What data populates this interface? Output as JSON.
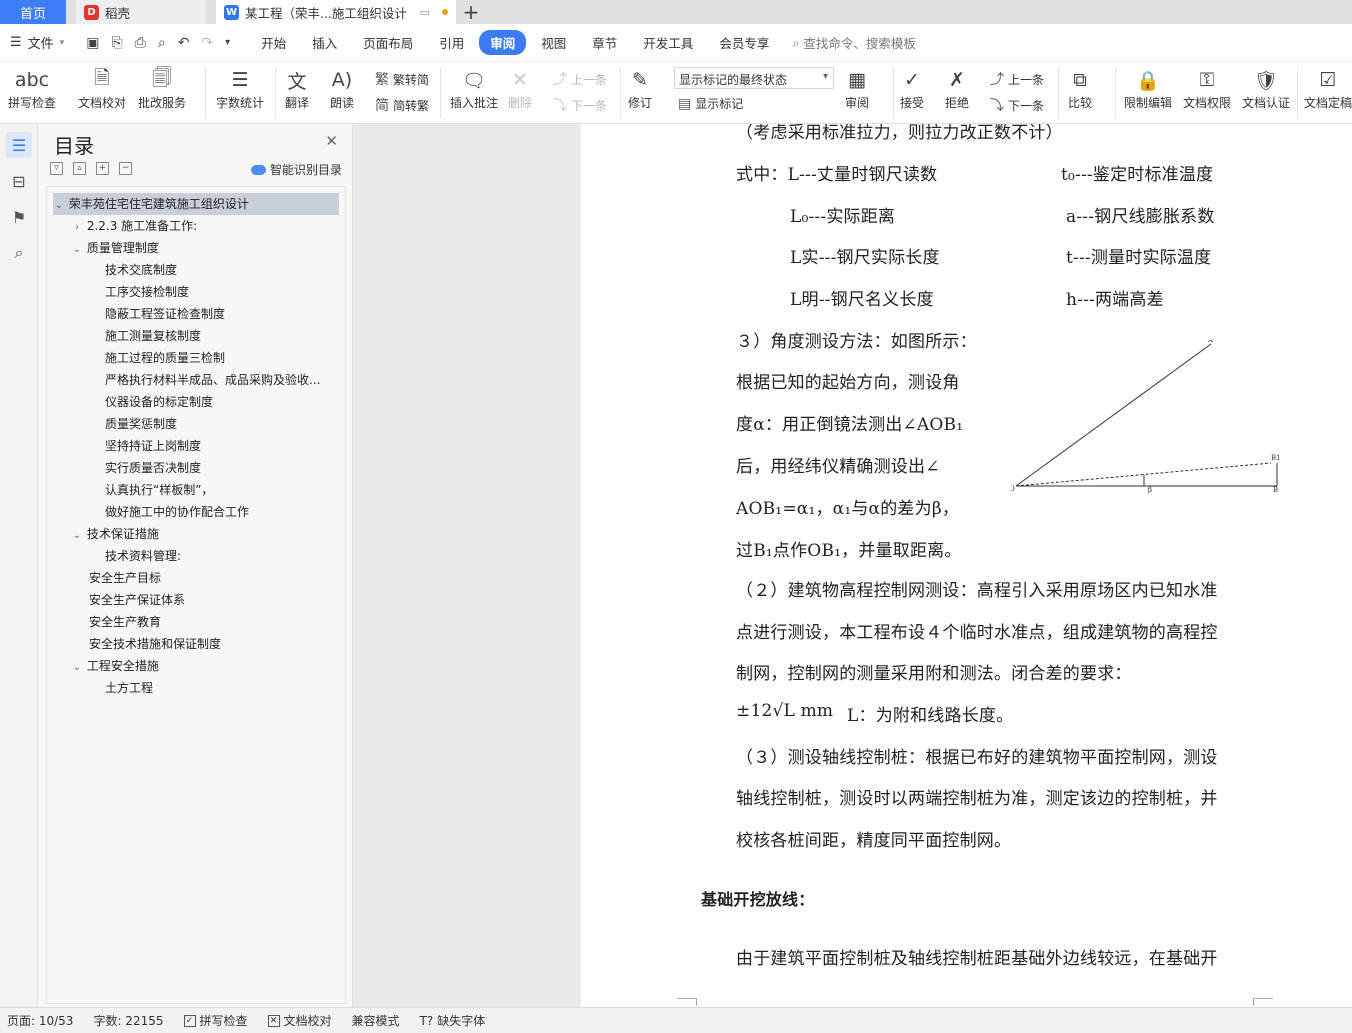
{
  "tabs": {
    "home": "首页",
    "daoke": "稻壳",
    "doc": "某工程（荣丰...施工组织设计",
    "add": "+"
  },
  "menu": {
    "file": "文件",
    "tabs": [
      "开始",
      "插入",
      "页面布局",
      "引用",
      "审阅",
      "视图",
      "章节",
      "开发工具",
      "会员专享"
    ],
    "active_tab": "审阅",
    "search": "查找命令、搜索模板"
  },
  "ribbon": {
    "spell": "拼写检查",
    "proof": "文档校对",
    "batch": "批改服务",
    "wordcount": "字数统计",
    "translate": "翻译",
    "read": "朗读",
    "t2s": "繁转简",
    "s2t": "简转繁",
    "insert_comment": "插入批注",
    "delete": "删除",
    "prev": "上一条",
    "next": "下一条",
    "revise": "修订",
    "markup_state": "显示标记的最终状态",
    "show_markup": "显示标记",
    "review": "审阅",
    "accept": "接受",
    "reject": "拒绝",
    "prev2": "上一条",
    "next2": "下一条",
    "compare": "比较",
    "restrict": "限制编辑",
    "rights": "文档权限",
    "auth": "文档认证",
    "finalize": "文档定稿"
  },
  "toc": {
    "title": "目录",
    "smart": "智能识别目录",
    "items": [
      "荣丰苑住宅住宅建筑施工组织设计",
      "2.2.3 施工准备工作:",
      "质量管理制度",
      "技术交底制度",
      "工序交接检制度",
      "隐蔽工程签证检查制度",
      "施工测量复核制度",
      "施工过程的质量三检制",
      "严格执行材料半成品、成品采购及验收...",
      "仪器设备的标定制度",
      "质量奖惩制度",
      "坚持持证上岗制度",
      "实行质量否决制度",
      "认真执行“样板制”，",
      "做好施工中的协作配合工作",
      "技术保证措施",
      "技术资料管理:",
      "安全生产目标",
      "安全生产保证体系",
      "安全生产教育",
      "安全技术措施和保证制度",
      "工程安全措施",
      "土方工程"
    ]
  },
  "doc": {
    "line0": "（考虑采用标准拉力，则拉力改正数不计）",
    "f1a": "式中：L---丈量时钢尺读数",
    "f1b": "t₀---鉴定时标准温度",
    "f2a": "L₀---实际距离",
    "f2b": "a---钢尺线膨胀系数",
    "f3a": "L实---钢尺实际长度",
    "f3b": "t---测量时实际温度",
    "f4a": "L明--钢尺名义长度",
    "f4b": "h---两端高差",
    "p1": "３）角度测设方法：如图所示：",
    "p2": "根据已知的起始方向，测设角",
    "p3": "度α：用正倒镜法测出∠AOB₁",
    "p4": "后，用经纬仪精确测设出∠",
    "p5": "AOB₁=α₁，α₁与α的差为β，",
    "p6": "过B₁点作OB₁，并量取距离。",
    "p7": "（２）建筑物高程控制网测设：高程引入采用原场区内已知水准",
    "p8": "点进行测设，本工程布设４个临时水准点，组成建筑物的高程控",
    "p9": "制网，控制网的测量采用附和测法。闭合差的要求：",
    "formula": "±12√L mm",
    "formula_note": "L：为附和线路长度。",
    "p10": "（３）测设轴线控制桩：根据已布好的建筑物平面控制网，测设",
    "p11": "轴线控制桩，测设时以两端控制桩为准，测定该边的控制桩，并",
    "p12": "校核各桩间距，精度同平面控制网。",
    "heading": "基础开挖放线：",
    "p13": "由于建筑平面控制桩及轴线控制桩距基础外边线较远，在基础开",
    "fig_labels": {
      "a": "A",
      "b1": "B1",
      "b": "B",
      "o": "O",
      "beta": "β"
    }
  },
  "status": {
    "page": "页面: 10/53",
    "words": "字数: 22155",
    "spell": "拼写检查",
    "proof": "文档校对",
    "compat": "兼容模式",
    "font": "缺失字体"
  }
}
